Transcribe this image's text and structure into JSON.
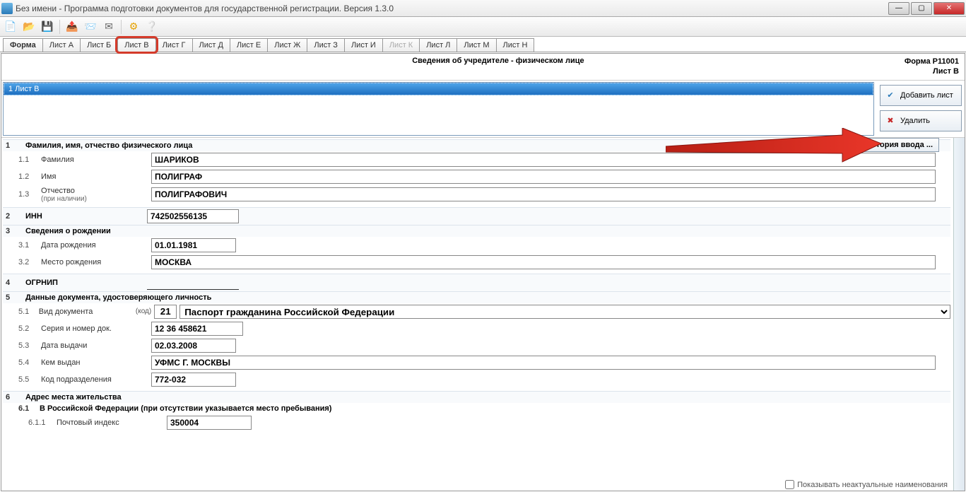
{
  "window": {
    "title": "Без имени - Программа подготовки документов для государственной регистрации. Версия 1.3.0"
  },
  "tabs": [
    {
      "label": "Форма",
      "bold": true
    },
    {
      "label": "Лист А"
    },
    {
      "label": "Лист Б"
    },
    {
      "label": "Лист В",
      "highlighted": true
    },
    {
      "label": "Лист Г"
    },
    {
      "label": "Лист Д"
    },
    {
      "label": "Лист Е"
    },
    {
      "label": "Лист Ж"
    },
    {
      "label": "Лист З"
    },
    {
      "label": "Лист И"
    },
    {
      "label": "Лист К",
      "disabled": true
    },
    {
      "label": "Лист Л"
    },
    {
      "label": "Лист М"
    },
    {
      "label": "Лист Н"
    }
  ],
  "header": {
    "center": "Сведения об учредителе - физическом лице",
    "right1": "Форма Р11001",
    "right2": "Лист В"
  },
  "list": {
    "row": "1 Лист В",
    "add_btn": "Добавить лист",
    "del_btn": "Удалить"
  },
  "history_btn": "история ввода ...",
  "sections": {
    "s1": {
      "num": "1",
      "title": "Фамилия, имя, отчество физического лица"
    },
    "s1_1": {
      "num": "1.1",
      "label": "Фамилия",
      "val": "ШАРИКОВ"
    },
    "s1_2": {
      "num": "1.2",
      "label": "Имя",
      "val": "ПОЛИГРАФ"
    },
    "s1_3": {
      "num": "1.3",
      "label": "Отчество",
      "sub": "(при наличии)",
      "val": "ПОЛИГРАФОВИЧ"
    },
    "s2": {
      "num": "2",
      "title": "ИНН",
      "val": "742502556135"
    },
    "s3": {
      "num": "3",
      "title": "Сведения о рождении"
    },
    "s3_1": {
      "num": "3.1",
      "label": "Дата рождения",
      "val": "01.01.1981"
    },
    "s3_2": {
      "num": "3.2",
      "label": "Место рождения",
      "val": "МОСКВА"
    },
    "s4": {
      "num": "4",
      "title": "ОГРНИП",
      "val": ""
    },
    "s5": {
      "num": "5",
      "title": "Данные документа, удостоверяющего личность"
    },
    "s5_1": {
      "num": "5.1",
      "label": "Вид документа",
      "codelbl": "(код)",
      "code": "21",
      "val": "Паспорт гражданина Российской Федерации"
    },
    "s5_2": {
      "num": "5.2",
      "label": "Серия и номер док.",
      "val": "12 36 458621"
    },
    "s5_3": {
      "num": "5.3",
      "label": "Дата выдачи",
      "val": "02.03.2008"
    },
    "s5_4": {
      "num": "5.4",
      "label": "Кем выдан",
      "val": "УФМС Г. МОСКВЫ"
    },
    "s5_5": {
      "num": "5.5",
      "label": "Код подразделения",
      "val": "772-032"
    },
    "s6": {
      "num": "6",
      "title": "Адрес места жительства"
    },
    "s6_1": {
      "num": "6.1",
      "title": "В Российской Федерации (при отсутствии указывается место пребывания)"
    },
    "s6_1_1": {
      "num": "6.1.1",
      "label": "Почтовый индекс",
      "val": "350004"
    }
  },
  "footer_cb": "Показывать неактуальные наименования"
}
